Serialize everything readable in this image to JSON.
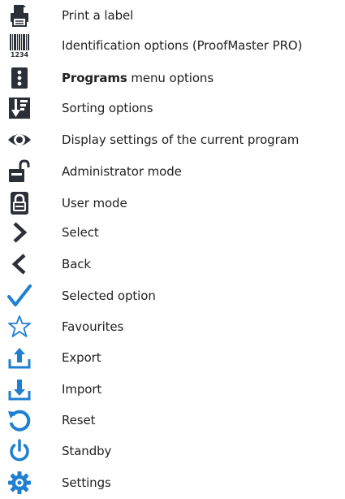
{
  "colors": {
    "dark": "#2b3038",
    "blue": "#1f7fd1",
    "text": "#222222"
  },
  "items": [
    {
      "icon": "printer-icon",
      "label": "Print a label"
    },
    {
      "icon": "barcode-icon",
      "label": "Identification options (ProofMaster PRO)",
      "icon_text": "1234"
    },
    {
      "icon": "vertical-dots-icon",
      "bold": "Programs",
      "label": " menu options"
    },
    {
      "icon": "sort-icon",
      "label": "Sorting options"
    },
    {
      "icon": "eye-icon",
      "label": "Display settings of the current program"
    },
    {
      "icon": "unlocked-padlock-icon",
      "label": "Administrator mode"
    },
    {
      "icon": "locked-padlock-icon",
      "label": "User mode"
    },
    {
      "icon": "chevron-right-icon",
      "label": "Select"
    },
    {
      "icon": "chevron-left-icon",
      "label": "Back"
    },
    {
      "icon": "checkmark-icon",
      "label": "Selected option"
    },
    {
      "icon": "star-outline-icon",
      "label": "Favourites"
    },
    {
      "icon": "export-icon",
      "label": "Export"
    },
    {
      "icon": "import-icon",
      "label": "Import"
    },
    {
      "icon": "reset-icon",
      "label": "Reset"
    },
    {
      "icon": "power-icon",
      "label": "Standby"
    },
    {
      "icon": "gear-icon",
      "label": "Settings"
    }
  ]
}
